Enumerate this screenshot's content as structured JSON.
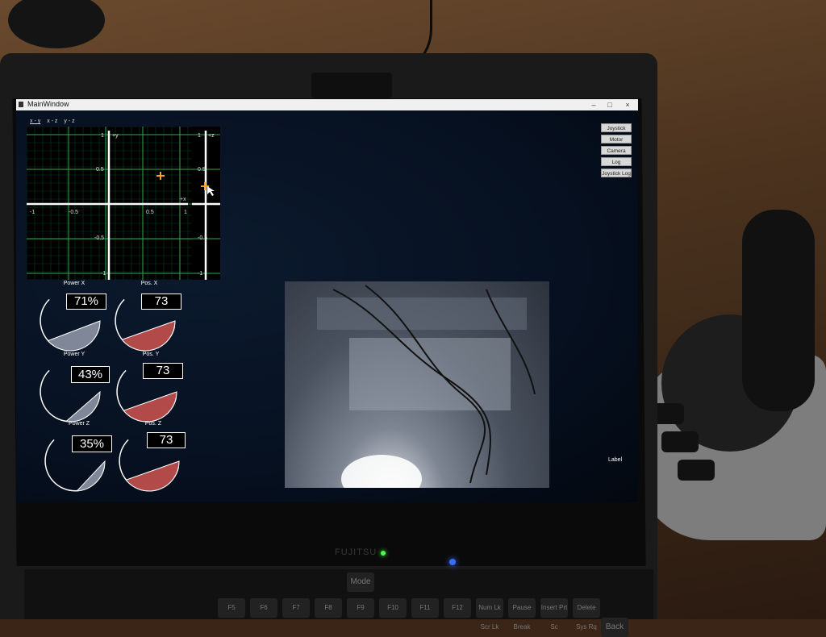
{
  "window": {
    "title": "MainWindow",
    "controls": [
      "–",
      "□",
      "×"
    ]
  },
  "plot": {
    "tabs": [
      "x - y",
      "x - z",
      "y - z"
    ],
    "active_tab": 0,
    "xy_ticks_x": [
      "-1",
      "-0.5",
      "0.5",
      "1"
    ],
    "xy_ticks_y": [
      "1",
      "0.5",
      "-0.5",
      "-1"
    ],
    "xz_ticks": [
      "1",
      "0.5",
      "-0.5",
      "-1"
    ],
    "axis_labels": {
      "y": "+y",
      "x": "+x",
      "z": "+z"
    },
    "cursor_color": "#ff9d2e",
    "grid_color": "#2fa84a",
    "axis_color": "#ffffff"
  },
  "side_buttons": [
    "Joystick",
    "Motor",
    "Camera",
    "Log",
    "Joystick Log"
  ],
  "gauges": [
    {
      "label": "Power X",
      "value_text": "71%",
      "value": 0.71,
      "fill": "#7f8799"
    },
    {
      "label": "Pos. X",
      "value_text": "73",
      "value": 0.73,
      "fill": "#b34a4a"
    },
    {
      "label": "Power Y",
      "value_text": "43%",
      "value": 0.43,
      "fill": "#7f8799"
    },
    {
      "label": "Pos. Y",
      "value_text": "73",
      "value": 0.73,
      "fill": "#b34a4a"
    },
    {
      "label": "Power Z",
      "value_text": "35%",
      "value": 0.35,
      "fill": "#7f8799"
    },
    {
      "label": "Pos. Z",
      "value_text": "73",
      "value": 0.73,
      "fill": "#b34a4a"
    }
  ],
  "camera": {
    "label": "Label"
  },
  "hardware": {
    "brand": "FUJITSU",
    "function_keys": [
      "F5",
      "F6",
      "F7",
      "F8",
      "F9",
      "F10",
      "F11",
      "F12",
      "Num Lk Scr Lk",
      "Pause Break",
      "Insert Prt Sc",
      "Delete Sys Rq"
    ],
    "media_keys": [
      "Mode"
    ],
    "backspace": "Back"
  }
}
